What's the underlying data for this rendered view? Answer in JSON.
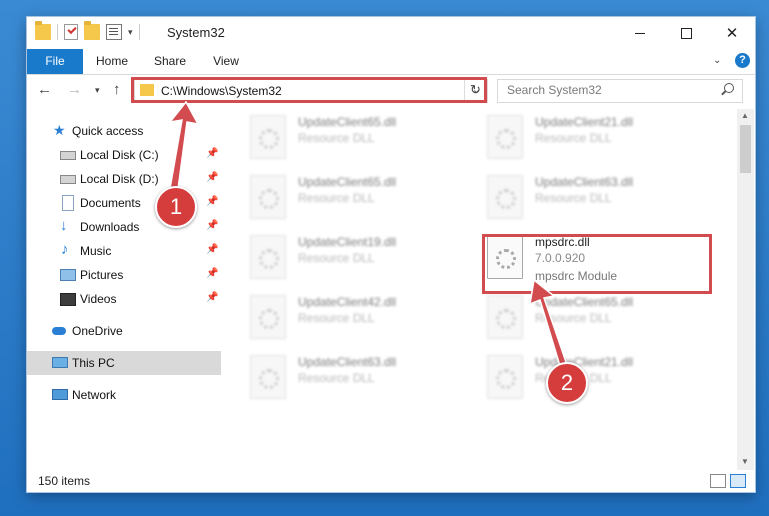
{
  "window": {
    "title": "System32",
    "ribbon_tabs": [
      "File",
      "Home",
      "Share",
      "View"
    ],
    "help_label": "?"
  },
  "address": {
    "path": "C:\\Windows\\System32"
  },
  "search": {
    "placeholder": "Search System32"
  },
  "sidebar": {
    "items": [
      {
        "label": "Quick access",
        "icon": "star-icon"
      },
      {
        "label": "Local Disk (C:)",
        "icon": "drive-icon"
      },
      {
        "label": "Local Disk (D:)",
        "icon": "drive-icon"
      },
      {
        "label": "Documents",
        "icon": "documents-icon"
      },
      {
        "label": "Downloads",
        "icon": "download-icon"
      },
      {
        "label": "Music",
        "icon": "music-icon"
      },
      {
        "label": "Pictures",
        "icon": "pictures-icon"
      },
      {
        "label": "Videos",
        "icon": "videos-icon"
      },
      {
        "label": "OneDrive",
        "icon": "cloud-icon"
      },
      {
        "label": "This PC",
        "icon": "computer-icon"
      },
      {
        "label": "Network",
        "icon": "network-icon"
      }
    ]
  },
  "files": [
    {
      "name": "UpdateClient65.dll",
      "desc": "Resource DLL"
    },
    {
      "name": "UpdateClient21.dll",
      "desc": "Resource DLL"
    },
    {
      "name": "UpdateClient65.dll",
      "desc": "Resource DLL"
    },
    {
      "name": "UpdateClient63.dll",
      "desc": "Resource DLL"
    },
    {
      "name": "UpdateClient19.dll",
      "desc": "Resource DLL"
    },
    {
      "name": "mpsdrc.dll",
      "version": "7.0.0.920",
      "desc": "mpsdrc Module"
    },
    {
      "name": "UpdateClient42.dll",
      "desc": "Resource DLL"
    },
    {
      "name": "UpdateClient65.dll",
      "desc": "Resource DLL"
    },
    {
      "name": "UpdateClient63.dll",
      "desc": "Resource DLL"
    },
    {
      "name": "UpdateClient21.dll",
      "desc": "Resource DLL"
    }
  ],
  "status": {
    "item_count": "150 items"
  },
  "annotations": {
    "step1": "1",
    "step2": "2",
    "color": "#d24b4f"
  }
}
